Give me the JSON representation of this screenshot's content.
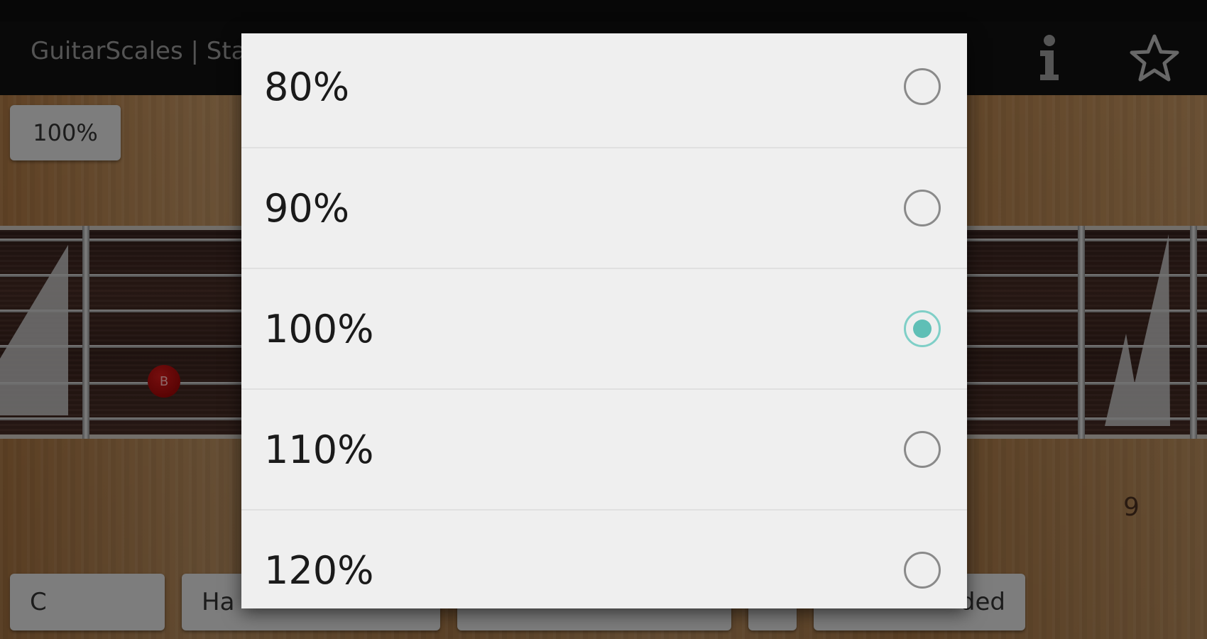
{
  "app": {
    "title": "GuitarScales | Sta"
  },
  "toolbar": {
    "info_icon": "info-icon",
    "favorite_icon": "star-icon"
  },
  "fretboard": {
    "zoom_button_label": "100%",
    "note_label": "B",
    "fret_number": "9"
  },
  "bottom_bar": {
    "items": [
      {
        "label": "C"
      },
      {
        "label": "Ha"
      },
      {
        "label": ""
      },
      {
        "label": ""
      },
      {
        "label": "ded"
      }
    ]
  },
  "zoom_dialog": {
    "options": [
      {
        "label": "80%",
        "selected": false
      },
      {
        "label": "90%",
        "selected": false
      },
      {
        "label": "100%",
        "selected": true
      },
      {
        "label": "110%",
        "selected": false
      },
      {
        "label": "120%",
        "selected": false
      }
    ]
  },
  "colors": {
    "radio_selected": "#5fbfb6",
    "dialog_background": "#efefef"
  }
}
